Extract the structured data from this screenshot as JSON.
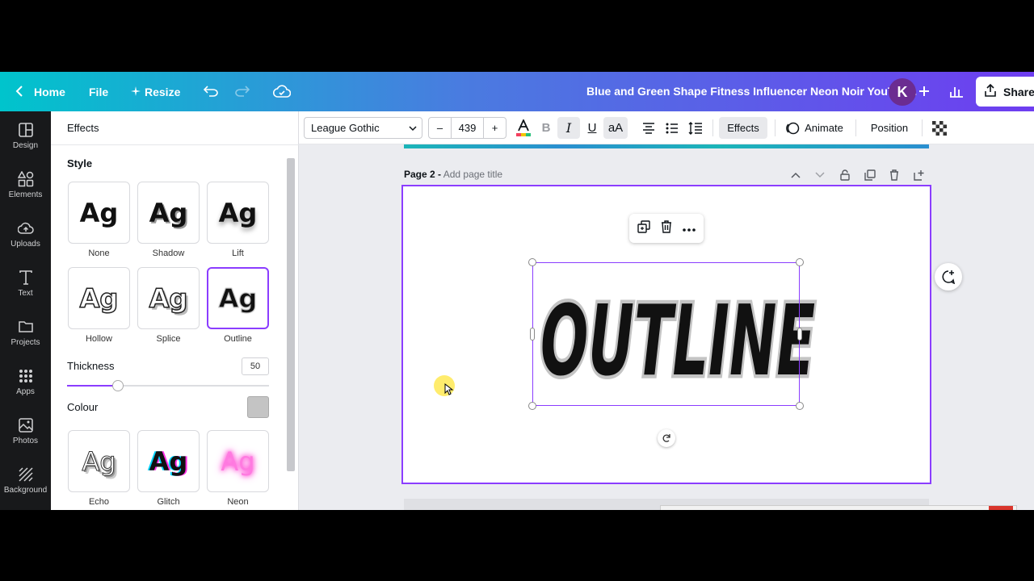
{
  "header": {
    "home_label": "Home",
    "file_label": "File",
    "resize_label": "Resize",
    "doc_title": "Blue and Green Shape Fitness Influencer Neon Noir YouTub...",
    "avatar_initial": "K",
    "share_label": "Share"
  },
  "sidebar": {
    "items": [
      {
        "label": "Design",
        "icon": "design-icon"
      },
      {
        "label": "Elements",
        "icon": "elements-icon"
      },
      {
        "label": "Uploads",
        "icon": "upload-icon"
      },
      {
        "label": "Text",
        "icon": "text-icon"
      },
      {
        "label": "Projects",
        "icon": "folder-icon"
      },
      {
        "label": "Apps",
        "icon": "apps-grid-icon"
      },
      {
        "label": "Photos",
        "icon": "photo-icon"
      },
      {
        "label": "Background",
        "icon": "background-icon"
      }
    ]
  },
  "panel": {
    "title": "Effects",
    "style_heading": "Style",
    "sample_text": "Ag",
    "styles": [
      "None",
      "Shadow",
      "Lift",
      "Hollow",
      "Splice",
      "Outline",
      "Echo",
      "Glitch",
      "Neon"
    ],
    "selected_style": "Outline",
    "thickness_label": "Thickness",
    "thickness_value": "50",
    "thickness_fraction": 0.25,
    "colour_label": "Colour",
    "colour_value": "#c4c4c4"
  },
  "toolbar": {
    "font_name": "League Gothic",
    "minus": "–",
    "font_size": "439",
    "plus": "+",
    "bold": "B",
    "italic": "I",
    "underline": "U",
    "case": "aA",
    "effects_label": "Effects",
    "animate_label": "Animate",
    "position_label": "Position"
  },
  "canvas": {
    "page_label": "Page 2 -",
    "page_title_placeholder": "Add page title",
    "text_content": "OUTLINE"
  },
  "colors": {
    "accent": "#8b3dff",
    "outline_grey": "#c4c4c4"
  }
}
